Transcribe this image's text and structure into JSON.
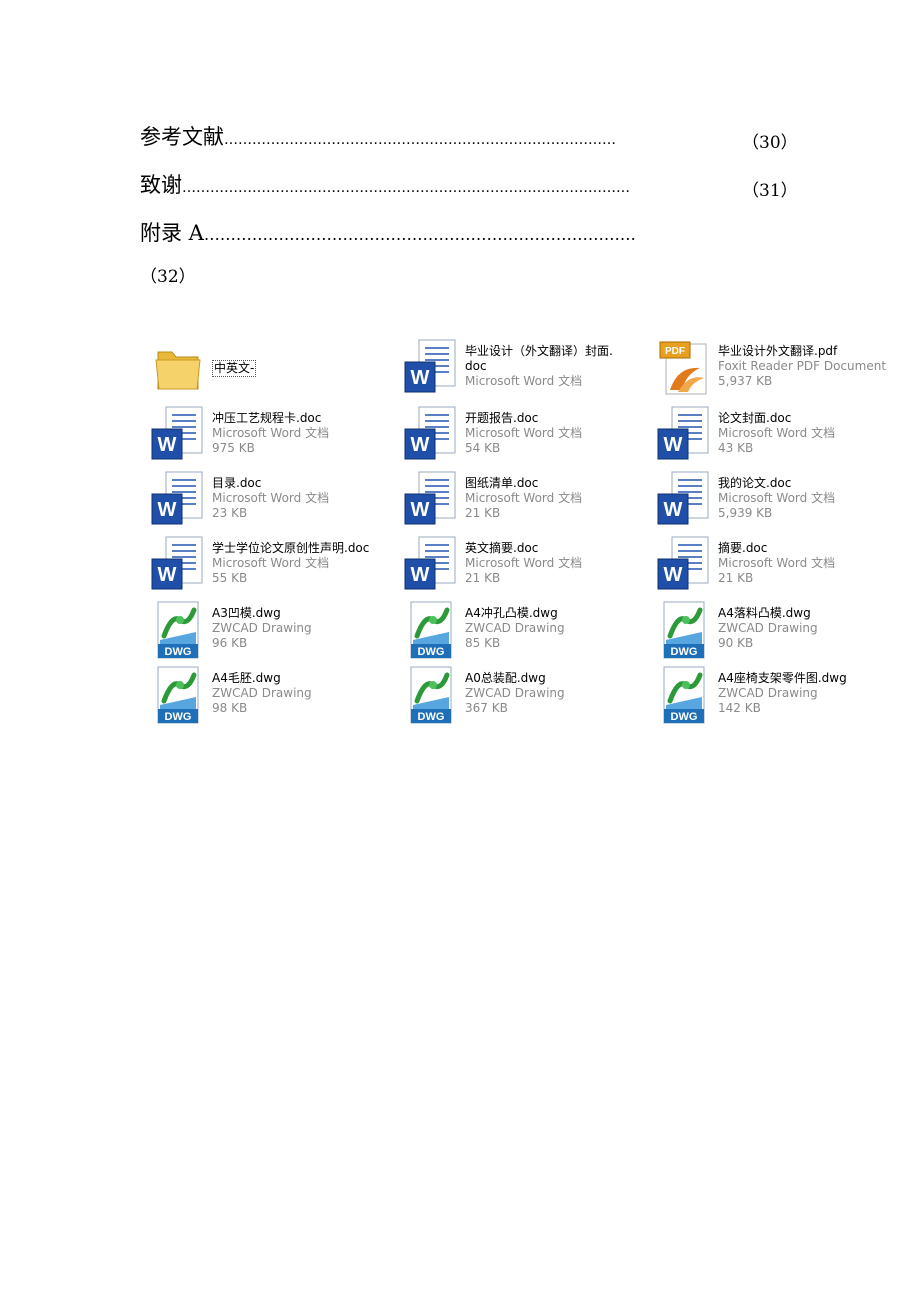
{
  "toc": [
    {
      "title": "参考文献",
      "dots": "…………………………………………………………………………",
      "page": "（30）"
    },
    {
      "title": "致谢",
      "dots": "……………………………………………………………………………………",
      "page": "（31）"
    },
    {
      "title": "附录 A",
      "dots": "………………………………………………………………………",
      "page": "（32）"
    }
  ],
  "files": [
    {
      "name": "中英文-",
      "type": "",
      "size": "",
      "icon": "folder-icon"
    },
    {
      "name": "毕业设计（外文翻译）封面.",
      "name2": "doc",
      "type": "Microsoft Word 文档",
      "size": "",
      "icon": "word-icon"
    },
    {
      "name": "毕业设计外文翻译.pdf",
      "type": "Foxit Reader PDF Document",
      "size": "5,937 KB",
      "icon": "pdf-icon"
    },
    {
      "name": "冲压工艺规程卡.doc",
      "type": "Microsoft Word 文档",
      "size": "975 KB",
      "icon": "word-icon"
    },
    {
      "name": "开题报告.doc",
      "type": "Microsoft Word 文档",
      "size": "54 KB",
      "icon": "word-icon"
    },
    {
      "name": "论文封面.doc",
      "type": "Microsoft Word 文档",
      "size": "43 KB",
      "icon": "word-icon"
    },
    {
      "name": "目录.doc",
      "type": "Microsoft Word 文档",
      "size": "23 KB",
      "icon": "word-icon"
    },
    {
      "name": "图纸清单.doc",
      "type": "Microsoft Word 文档",
      "size": "21 KB",
      "icon": "word-icon"
    },
    {
      "name": "我的论文.doc",
      "type": "Microsoft Word 文档",
      "size": "5,939 KB",
      "icon": "word-icon"
    },
    {
      "name": "学士学位论文原创性声明.doc",
      "type": "Microsoft Word 文档",
      "size": "55 KB",
      "icon": "word-icon"
    },
    {
      "name": "英文摘要.doc",
      "type": "Microsoft Word 文档",
      "size": "21 KB",
      "icon": "word-icon"
    },
    {
      "name": "摘要.doc",
      "type": "Microsoft Word 文档",
      "size": "21 KB",
      "icon": "word-icon"
    },
    {
      "name": "A3凹模.dwg",
      "type": "ZWCAD Drawing",
      "size": "96 KB",
      "icon": "dwg-icon"
    },
    {
      "name": "A4冲孔凸模.dwg",
      "type": "ZWCAD Drawing",
      "size": "85 KB",
      "icon": "dwg-icon"
    },
    {
      "name": "A4落料凸模.dwg",
      "type": "ZWCAD Drawing",
      "size": "90 KB",
      "icon": "dwg-icon"
    },
    {
      "name": "A4毛胚.dwg",
      "type": "ZWCAD Drawing",
      "size": "98 KB",
      "icon": "dwg-icon"
    },
    {
      "name": "A0总装配.dwg",
      "type": "ZWCAD Drawing",
      "size": "367 KB",
      "icon": "dwg-icon"
    },
    {
      "name": "A4座椅支架零件图.dwg",
      "type": "ZWCAD Drawing",
      "size": "142 KB",
      "icon": "dwg-icon"
    }
  ],
  "icon_labels": {
    "word": "W",
    "pdf": "PDF",
    "dwg": "DWG"
  },
  "colors": {
    "word_blue": "#1f4fa8",
    "pdf_orange": "#e8a020",
    "dwg_blue": "#1f6fb8",
    "folder": "#f2c94c"
  }
}
